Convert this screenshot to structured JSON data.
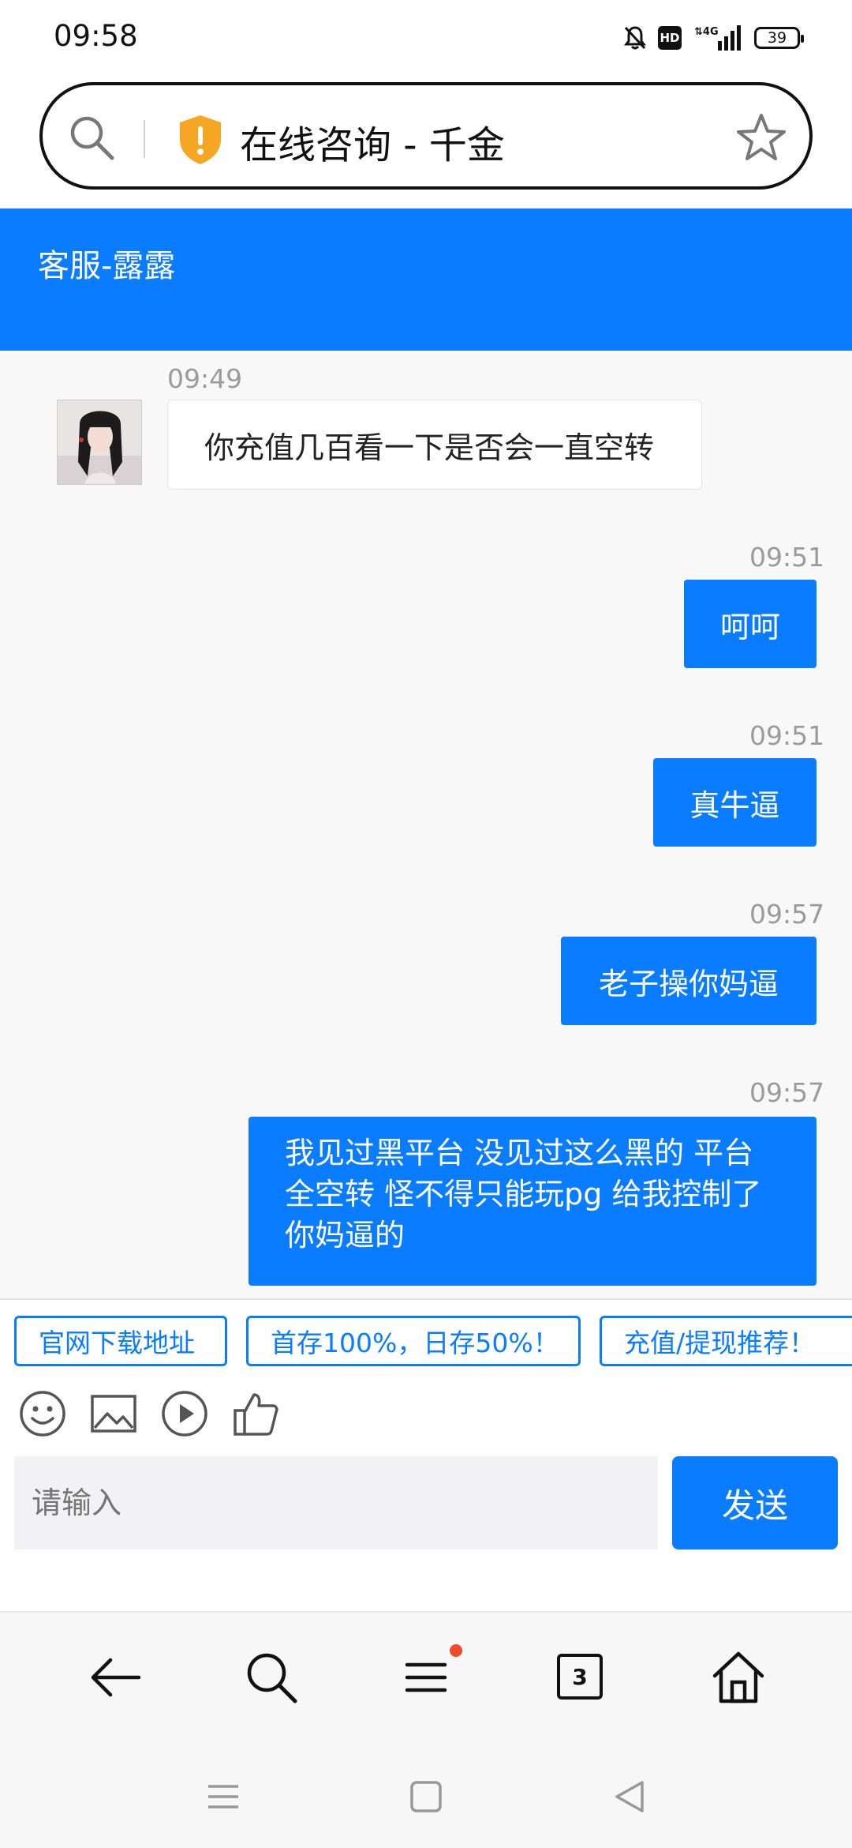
{
  "status_bar": {
    "time": "09:58",
    "network": "4G",
    "hd_label": "HD",
    "battery": "39"
  },
  "address_bar": {
    "title": "在线咨询 - 千金",
    "security_color": "#f5a623"
  },
  "chat": {
    "agent_name": "客服-露露",
    "accent_color": "#0a7cff",
    "messages": [
      {
        "from": "agent",
        "time": "09:49",
        "text": "你充值几百看一下是否会一直空转"
      },
      {
        "from": "user",
        "time": "09:51",
        "text": "呵呵"
      },
      {
        "from": "user",
        "time": "09:51",
        "text": "真牛逼"
      },
      {
        "from": "user",
        "time": "09:57",
        "text": "老子操你妈逼"
      },
      {
        "from": "user",
        "time": "09:57",
        "lines": [
          "我见过黑平台 没见过这么黑的 平台",
          "全空转 怪不得只能玩pg 给我控制了",
          "你妈逼的"
        ]
      }
    ]
  },
  "quick_replies": [
    "官网下载地址",
    "首存100%，日存50%！",
    "充值/提现推荐！"
  ],
  "tools": [
    "emoji-icon",
    "image-icon",
    "video-icon",
    "thumbs-up-icon"
  ],
  "input": {
    "placeholder": "请输入",
    "send_label": "发送"
  },
  "browser_nav": {
    "tab_count": "3"
  }
}
